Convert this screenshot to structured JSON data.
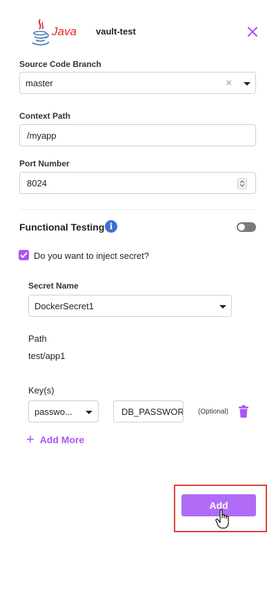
{
  "header": {
    "logo_text": "Java",
    "title": "vault-test",
    "close_icon": "close-x-icon"
  },
  "form": {
    "branch_label": "Source Code Branch",
    "branch_value": "master",
    "context_label": "Context Path",
    "context_value": "/myapp",
    "port_label": "Port Number",
    "port_value": "8024"
  },
  "functional": {
    "title": "Functional Testing",
    "info_icon": "i",
    "toggle_on": false
  },
  "secret": {
    "checkbox_label": "Do you want to inject secret?",
    "checked": true,
    "name_label": "Secret Name",
    "name_value": "DockerSecret1",
    "path_label": "Path",
    "path_value": "test/app1",
    "keys_label": "Key(s)",
    "key_select_value": "passwo...",
    "key_env_value": "DB_PASSWOR",
    "optional_label": "(Optional)",
    "add_more_label": "Add More"
  },
  "footer": {
    "add_label": "Add"
  },
  "colors": {
    "accent": "#a855f7",
    "button": "#b06cf7",
    "highlight": "#e53935",
    "info": "#3f6fd6"
  }
}
